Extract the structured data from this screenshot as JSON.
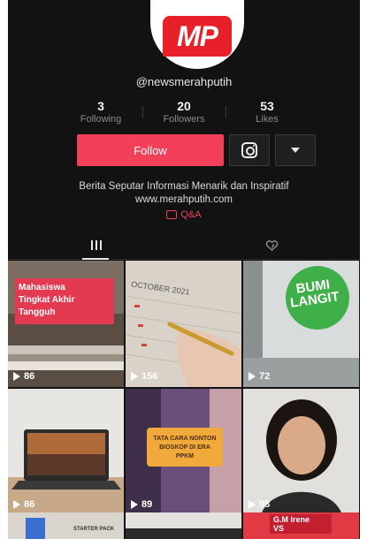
{
  "profile": {
    "avatar_text": "MP",
    "username": "@newsmerahputih",
    "stats": [
      {
        "value": "3",
        "label": "Following"
      },
      {
        "value": "20",
        "label": "Followers"
      },
      {
        "value": "53",
        "label": "Likes"
      }
    ],
    "follow_label": "Follow",
    "bio_line1": "Berita Seputar Informasi Menarik dan Inspiratif",
    "bio_line2": "www.merahputih.com",
    "qa_label": "Q&A"
  },
  "colors": {
    "accent": "#f2405a",
    "background": "#121212",
    "brand_red": "#e8202a"
  },
  "tabs": [
    {
      "icon": "grid-icon",
      "active": true
    },
    {
      "icon": "liked-heart-icon",
      "active": false
    }
  ],
  "videos": [
    {
      "views": "86",
      "caption_lines": [
        "Mahasiswa",
        "Tingkat Akhir",
        "Tangguh"
      ]
    },
    {
      "views": "156",
      "caption_lines": [
        "OCTOBER 2021"
      ]
    },
    {
      "views": "72",
      "caption_lines": [
        "BUMI",
        "LANGIT"
      ]
    },
    {
      "views": "86",
      "caption_lines": []
    },
    {
      "views": "89",
      "caption_lines": [
        "TATA CARA NONTON",
        "BIOSKOP DI ERA",
        "PPKM"
      ]
    },
    {
      "views": "98",
      "caption_lines": []
    }
  ],
  "partial_videos": [
    {
      "caption": "STARTER PACK"
    },
    {
      "caption": ""
    },
    {
      "caption_lines": [
        "G.M Irene",
        "VS"
      ]
    }
  ]
}
